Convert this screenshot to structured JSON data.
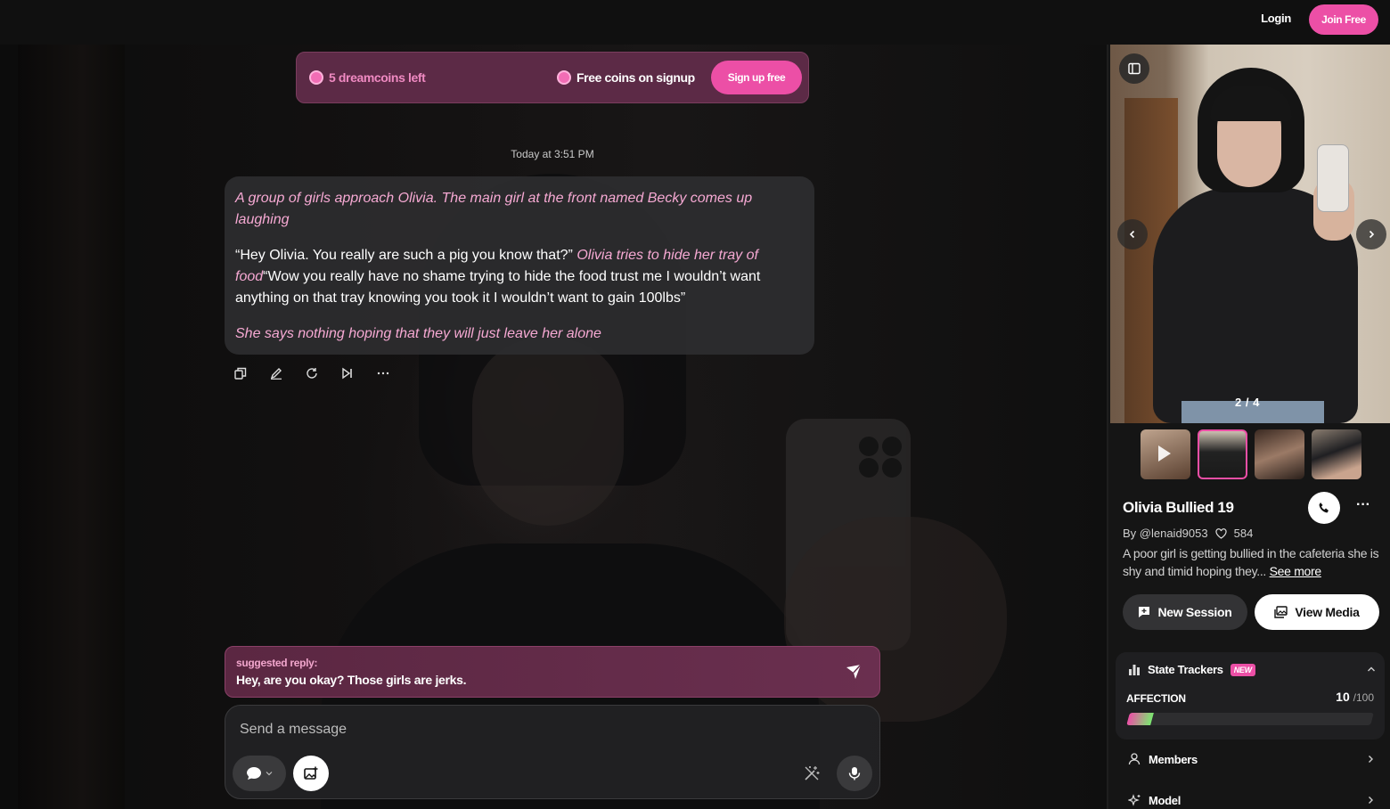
{
  "topbar": {
    "login": "Login",
    "join": "Join Free"
  },
  "banner": {
    "coins_left": "5 dreamcoins left",
    "free_coins": "Free coins on signup",
    "signup": "Sign up free"
  },
  "chat": {
    "timestamp": "Today at 3:51 PM",
    "message": {
      "p1": "A group of girls approach Olivia. The main girl at the front named Becky comes up laughing",
      "p2_quote1": "“Hey Olivia. You really are such a pig you know that?”",
      "p2_action": "Olivia tries to hide her tray of food",
      "p2_quote2": "“Wow you really have no shame trying to hide the food trust me I wouldn’t want anything on that tray knowing you took it I wouldn’t want to gain 100lbs”",
      "p3": "She says nothing hoping that they will just leave her alone"
    },
    "actions": [
      "copy-icon",
      "edit-icon",
      "regenerate-icon",
      "continue-icon",
      "more-icon"
    ],
    "suggested": {
      "label": "suggested reply:",
      "text": "Hey, are you okay? Those girls are jerks."
    },
    "input": {
      "placeholder": "Send a message",
      "value": ""
    }
  },
  "panel": {
    "counter": "2 / 4",
    "name": "Olivia Bullied 19",
    "author": "By @lenaid9053",
    "likes": "584",
    "description": "A poor girl is getting bullied in the cafeteria she is shy and timid hoping they...",
    "see_more": "See more",
    "new_session": "New Session",
    "view_media": "View Media",
    "trackers": {
      "title": "State Trackers",
      "badge": "NEW",
      "affection_label": "AFFECTION",
      "affection_value": "10",
      "affection_max": "/100",
      "affection_fraction": 0.1
    },
    "members": "Members",
    "model": "Model"
  },
  "colors": {
    "accent": "#ec4fa6",
    "bubble": "#2c2c2e",
    "suggest": "#5b2742"
  }
}
